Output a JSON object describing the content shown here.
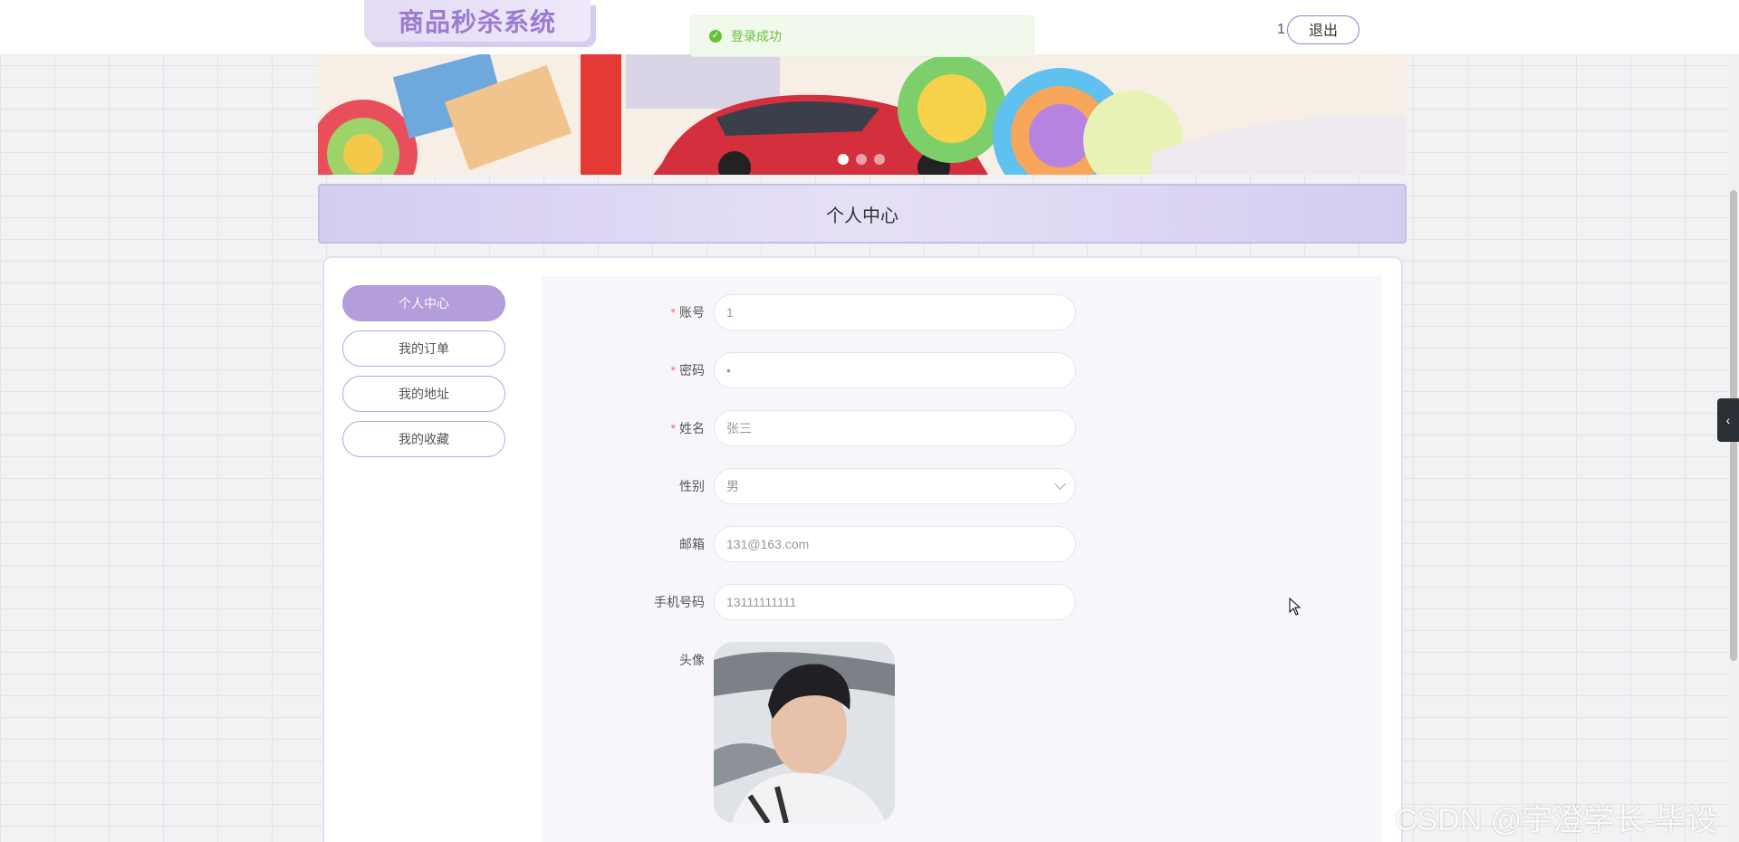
{
  "header": {
    "logo_title": "商品秒杀系统",
    "username": "1",
    "logout_label": "退出"
  },
  "toast": {
    "message": "登录成功"
  },
  "banner": {
    "slide_count": 3,
    "active_slide": 1
  },
  "section": {
    "title": "个人中心"
  },
  "sidebar": {
    "items": [
      {
        "label": "个人中心",
        "active": true
      },
      {
        "label": "我的订单",
        "active": false
      },
      {
        "label": "我的地址",
        "active": false
      },
      {
        "label": "我的收藏",
        "active": false
      }
    ]
  },
  "form": {
    "account": {
      "label": "账号",
      "required": true,
      "value": "1"
    },
    "password": {
      "label": "密码",
      "required": true,
      "value": "•"
    },
    "name": {
      "label": "姓名",
      "required": true,
      "value": "张三"
    },
    "gender": {
      "label": "性别",
      "required": false,
      "value": "男"
    },
    "email": {
      "label": "邮箱",
      "required": false,
      "value": "131@163.com"
    },
    "phone": {
      "label": "手机号码",
      "required": false,
      "value": "13111111111"
    },
    "avatar": {
      "label": "头像"
    }
  },
  "watermark": "CSDN @宇澄学长-毕设",
  "colors": {
    "accent": "#b39ddb",
    "success": "#67c23a",
    "required": "#f56c6c"
  }
}
